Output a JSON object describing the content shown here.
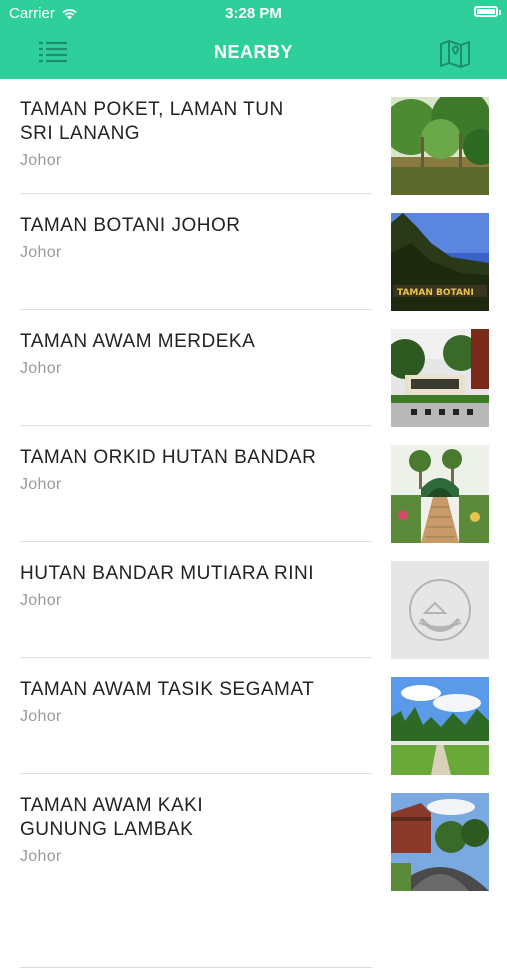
{
  "status_bar": {
    "carrier": "Carrier",
    "time": "3:28 PM"
  },
  "nav": {
    "title": "NEARBY",
    "menu_icon": "list-icon",
    "map_icon": "map-icon"
  },
  "colors": {
    "accent": "#2fcf9b",
    "title_text": "#222222",
    "subtitle_text": "#9b9b9b",
    "divider": "#dcdcdc"
  },
  "places": [
    {
      "title_line1": "TAMAN POKET,  LAMAN TUN",
      "title_line2": "SRI LANANG",
      "state": "Johor",
      "thumb": "garden-trees"
    },
    {
      "title_line1": "TAMAN BOTANI JOHOR",
      "title_line2": "",
      "state": "Johor",
      "thumb": "botanical-sign"
    },
    {
      "title_line1": "TAMAN AWAM MERDEKA",
      "title_line2": "",
      "state": "Johor",
      "thumb": "park-entrance"
    },
    {
      "title_line1": "TAMAN ORKID HUTAN BANDAR",
      "title_line2": "",
      "state": "Johor",
      "thumb": "orchid-garden"
    },
    {
      "title_line1": "HUTAN BANDAR MUTIARA RINI",
      "title_line2": "",
      "state": "Johor",
      "thumb": "placeholder-logo"
    },
    {
      "title_line1": "TAMAN AWAM TASIK SEGAMAT",
      "title_line2": "",
      "state": "Johor",
      "thumb": "lake-park"
    },
    {
      "title_line1": "TAMAN AWAM KAKI",
      "title_line2": "GUNUNG LAMBAK",
      "state": "Johor",
      "thumb": "mountain-park"
    }
  ]
}
